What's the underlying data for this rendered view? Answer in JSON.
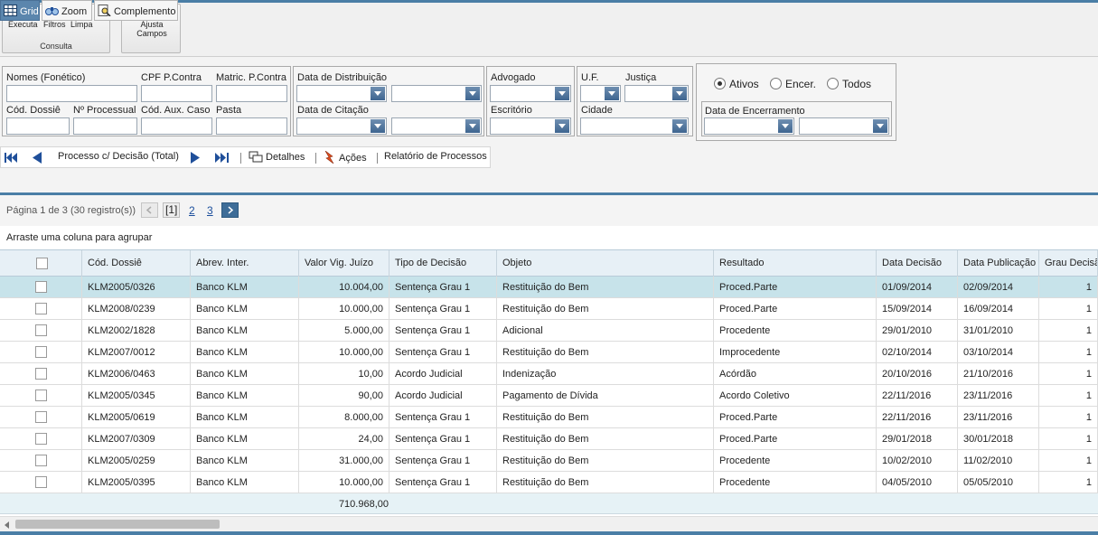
{
  "ribbon": {
    "consulta_group": "Consulta",
    "executa": "Executa",
    "filtros": "Filtros",
    "limpa": "Limpa",
    "ajusta_campos": "Ajusta Campos"
  },
  "filters": {
    "nomes": "Nomes (Fonético)",
    "cpf": "CPF P.Contra",
    "matric": "Matric. P.Contra",
    "cod_dossie": "Cód. Dossiê",
    "n_processual": "Nº Processual",
    "cod_aux": "Cód. Aux. Caso",
    "pasta": "Pasta",
    "data_distribuicao": "Data de Distribuição",
    "data_citacao": "Data de Citação",
    "advogado": "Advogado",
    "escritorio": "Escritório",
    "uf": "U.F.",
    "justica": "Justiça",
    "cidade": "Cidade",
    "ativos": "Ativos",
    "encer": "Encer.",
    "todos": "Todos",
    "data_encerramento": "Data de Encerramento",
    "selected_status": "Ativos"
  },
  "nav": {
    "label": "Processo c/ Decisão (Total)",
    "detalhes": "Detalhes",
    "acoes": "Ações",
    "relatorio": "Relatório de Processos"
  },
  "tabs": [
    "Grid",
    "Zoom",
    "Complemento"
  ],
  "pager": {
    "text": "Página 1 de 3 (30 registro(s))",
    "current": "[1]",
    "p2": "2",
    "p3": "3"
  },
  "group_hint": "Arraste uma coluna para agrupar",
  "grid": {
    "columns": [
      "Cód. Dossiê",
      "Abrev. Inter.",
      "Valor Vig. Juízo",
      "Tipo de Decisão",
      "Objeto",
      "Resultado",
      "Data Decisão",
      "Data Publicação",
      "Grau Decisã"
    ],
    "rows": [
      [
        "KLM2005/0326",
        "Banco KLM",
        "10.004,00",
        "Sentença Grau 1",
        "Restituição do Bem",
        "Proced.Parte",
        "01/09/2014",
        "02/09/2014",
        "1"
      ],
      [
        "KLM2008/0239",
        "Banco KLM",
        "10.000,00",
        "Sentença Grau 1",
        "Restituição do Bem",
        "Proced.Parte",
        "15/09/2014",
        "16/09/2014",
        "1"
      ],
      [
        "KLM2002/1828",
        "Banco KLM",
        "5.000,00",
        "Sentença Grau 1",
        "Adicional",
        "Procedente",
        "29/01/2010",
        "31/01/2010",
        "1"
      ],
      [
        "KLM2007/0012",
        "Banco KLM",
        "10.000,00",
        "Sentença Grau 1",
        "Restituição do Bem",
        "Improcedente",
        "02/10/2014",
        "03/10/2014",
        "1"
      ],
      [
        "KLM2006/0463",
        "Banco KLM",
        "10,00",
        "Acordo Judicial",
        "Indenização",
        "Acórdão",
        "20/10/2016",
        "21/10/2016",
        "1"
      ],
      [
        "KLM2005/0345",
        "Banco KLM",
        "90,00",
        "Acordo Judicial",
        "Pagamento de Dívida",
        "Acordo Coletivo",
        "22/11/2016",
        "23/11/2016",
        "1"
      ],
      [
        "KLM2005/0619",
        "Banco KLM",
        "8.000,00",
        "Sentença Grau 1",
        "Restituição do Bem",
        "Proced.Parte",
        "22/11/2016",
        "23/11/2016",
        "1"
      ],
      [
        "KLM2007/0309",
        "Banco KLM",
        "24,00",
        "Sentença Grau 1",
        "Restituição do Bem",
        "Proced.Parte",
        "29/01/2018",
        "30/01/2018",
        "1"
      ],
      [
        "KLM2005/0259",
        "Banco KLM",
        "31.000,00",
        "Sentença Grau 1",
        "Restituição do Bem",
        "Procedente",
        "10/02/2010",
        "11/02/2010",
        "1"
      ],
      [
        "KLM2005/0395",
        "Banco KLM",
        "10.000,00",
        "Sentença Grau 1",
        "Restituição do Bem",
        "Procedente",
        "04/05/2010",
        "05/05/2010",
        "1"
      ]
    ],
    "total": "710.968,00"
  }
}
